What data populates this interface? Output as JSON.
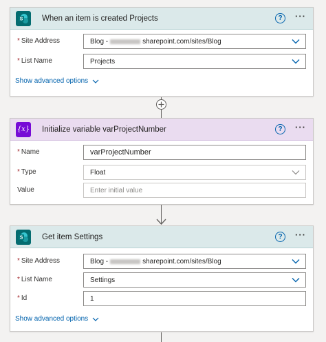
{
  "card1": {
    "title": "When an item is created Projects",
    "fields": [
      {
        "label": "Site Address",
        "required": "*",
        "value_prefix": "Blog - ",
        "value_suffix": "sharepoint.com/sites/Blog"
      },
      {
        "label": "List Name",
        "required": "*",
        "value": "Projects"
      }
    ],
    "advanced": "Show advanced options"
  },
  "card2": {
    "title": "Initialize variable varProjectNumber",
    "icon_text": "{x}",
    "fields": [
      {
        "label": "Name",
        "required": "*",
        "value": "varProjectNumber"
      },
      {
        "label": "Type",
        "required": "*",
        "value": "Float"
      },
      {
        "label": "Value",
        "placeholder": "Enter initial value"
      }
    ]
  },
  "card3": {
    "title": "Get item Settings",
    "fields": [
      {
        "label": "Site Address",
        "required": "*",
        "value_prefix": "Blog - ",
        "value_suffix": "sharepoint.com/sites/Blog"
      },
      {
        "label": "List Name",
        "required": "*",
        "value": "Settings"
      },
      {
        "label": "Id",
        "required": "*",
        "value": "1"
      }
    ],
    "advanced": "Show advanced options"
  },
  "common": {
    "help_glyph": "?",
    "more_glyph": "···",
    "sharepoint_letter": "S"
  },
  "colors": {
    "teal_header": "#dbe9ea",
    "purple_header": "#eadcf0",
    "sharepoint": "#036c70",
    "variable": "#770bd6",
    "link": "#0062ad",
    "required": "#a4262c"
  }
}
